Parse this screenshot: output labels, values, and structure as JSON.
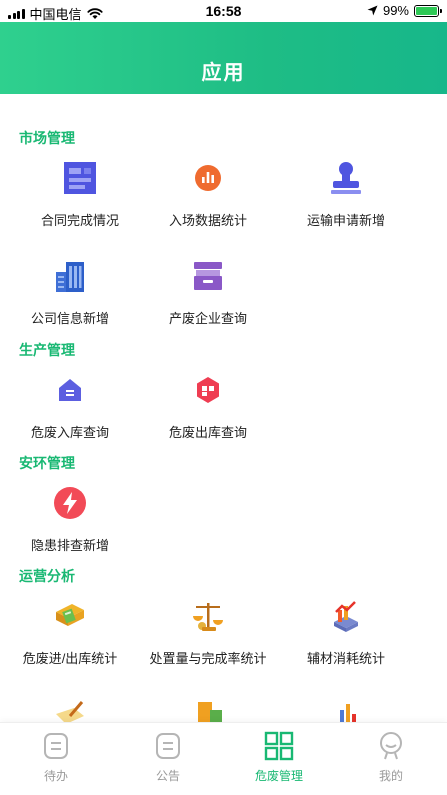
{
  "status_bar": {
    "carrier": "中国电信",
    "time": "16:58",
    "battery": "99%"
  },
  "header": {
    "title": "应用"
  },
  "sections": [
    {
      "title": "市场管理",
      "items": [
        {
          "label": "合同完成情况",
          "icon": "contract-board-icon"
        },
        {
          "label": "入场数据统计",
          "icon": "entry-stats-icon"
        },
        {
          "label": "运输申请新增",
          "icon": "stamp-icon"
        },
        {
          "label": "公司信息新增",
          "icon": "building-icon"
        },
        {
          "label": "产废企业查询",
          "icon": "archive-box-icon"
        }
      ]
    },
    {
      "title": "生产管理",
      "items": [
        {
          "label": "危废入库查询",
          "icon": "warehouse-in-icon"
        },
        {
          "label": "危废出库查询",
          "icon": "warehouse-out-icon"
        }
      ]
    },
    {
      "title": "安环管理",
      "items": [
        {
          "label": "隐患排查新增",
          "icon": "lightning-alert-icon"
        }
      ]
    },
    {
      "title": "运营分析",
      "items": [
        {
          "label": "危废进/出库统计",
          "icon": "ledger-calculator-icon"
        },
        {
          "label": "处置量与完成率统计",
          "icon": "balance-scale-icon"
        },
        {
          "label": "辅材消耗统计",
          "icon": "materials-chart-icon"
        },
        {
          "label": "",
          "icon": "notebook-pen-icon"
        },
        {
          "label": "",
          "icon": "money-stack-icon"
        },
        {
          "label": "",
          "icon": "bar-growth-icon"
        }
      ]
    }
  ],
  "tabbar": [
    {
      "label": "待办",
      "icon": "todo-icon",
      "active": false
    },
    {
      "label": "公告",
      "icon": "notice-icon",
      "active": false
    },
    {
      "label": "危废管理",
      "icon": "grid-apps-icon",
      "active": true
    },
    {
      "label": "我的",
      "icon": "profile-icon",
      "active": false
    }
  ],
  "colors": {
    "header_start": "#2fd08e",
    "header_end": "#17b78a",
    "section_title": "#19b873",
    "tab_active": "#19b873",
    "tab_inactive": "#9a9a9a"
  }
}
